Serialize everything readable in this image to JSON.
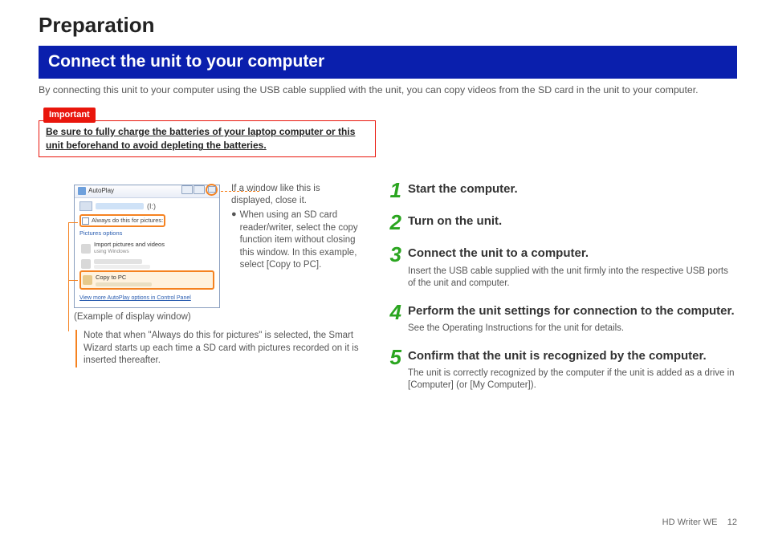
{
  "header": {
    "title": "Preparation",
    "banner": "Connect the unit to your computer",
    "intro": "By connecting this unit to your computer using the USB cable supplied with the unit, you can copy videos from the SD card in the unit to your computer."
  },
  "important": {
    "tag": "Important",
    "text": "Be sure to fully charge the batteries of your laptop computer or this unit beforehand to avoid depleting the batteries."
  },
  "autoplay": {
    "window_title": "AutoPlay",
    "drive_suffix": "(I:)",
    "checkbox_label": "Always do this for pictures:",
    "section_label": "Pictures options",
    "item1_title": "Import pictures and videos",
    "item1_sub": "using Windows",
    "item2_title_blur": "",
    "item2_sub_blur": "",
    "item3_title": "Copy to PC",
    "item3_sub_blur": "",
    "footer_link": "View more AutoPlay options in Control Panel",
    "caption": "(Example of display window)",
    "side_note_line1": "If a window like this is displayed, close it.",
    "side_note_bullet": "When using an SD card reader/writer, select the copy function item without closing this window. In this example, select [Copy to PC].",
    "below_note": "Note that when \"Always do this for pictures\" is selected, the Smart Wizard starts up each time a SD card with pictures recorded on it is inserted thereafter."
  },
  "steps": [
    {
      "num": "1",
      "title": "Start the computer.",
      "desc": ""
    },
    {
      "num": "2",
      "title": "Turn on the unit.",
      "desc": ""
    },
    {
      "num": "3",
      "title": "Connect the unit to a computer.",
      "desc": "Insert the USB cable supplied with the unit firmly into the respective USB ports of the unit and computer."
    },
    {
      "num": "4",
      "title": "Perform the unit settings for connection to the computer.",
      "desc": "See the Operating Instructions for the unit for details."
    },
    {
      "num": "5",
      "title": "Confirm that the unit is recognized by the computer.",
      "desc": "The unit is correctly recognized by the computer if the unit is added as a drive in [Computer] (or [My Computer])."
    }
  ],
  "footer": {
    "product": "HD Writer WE",
    "page": "12"
  }
}
